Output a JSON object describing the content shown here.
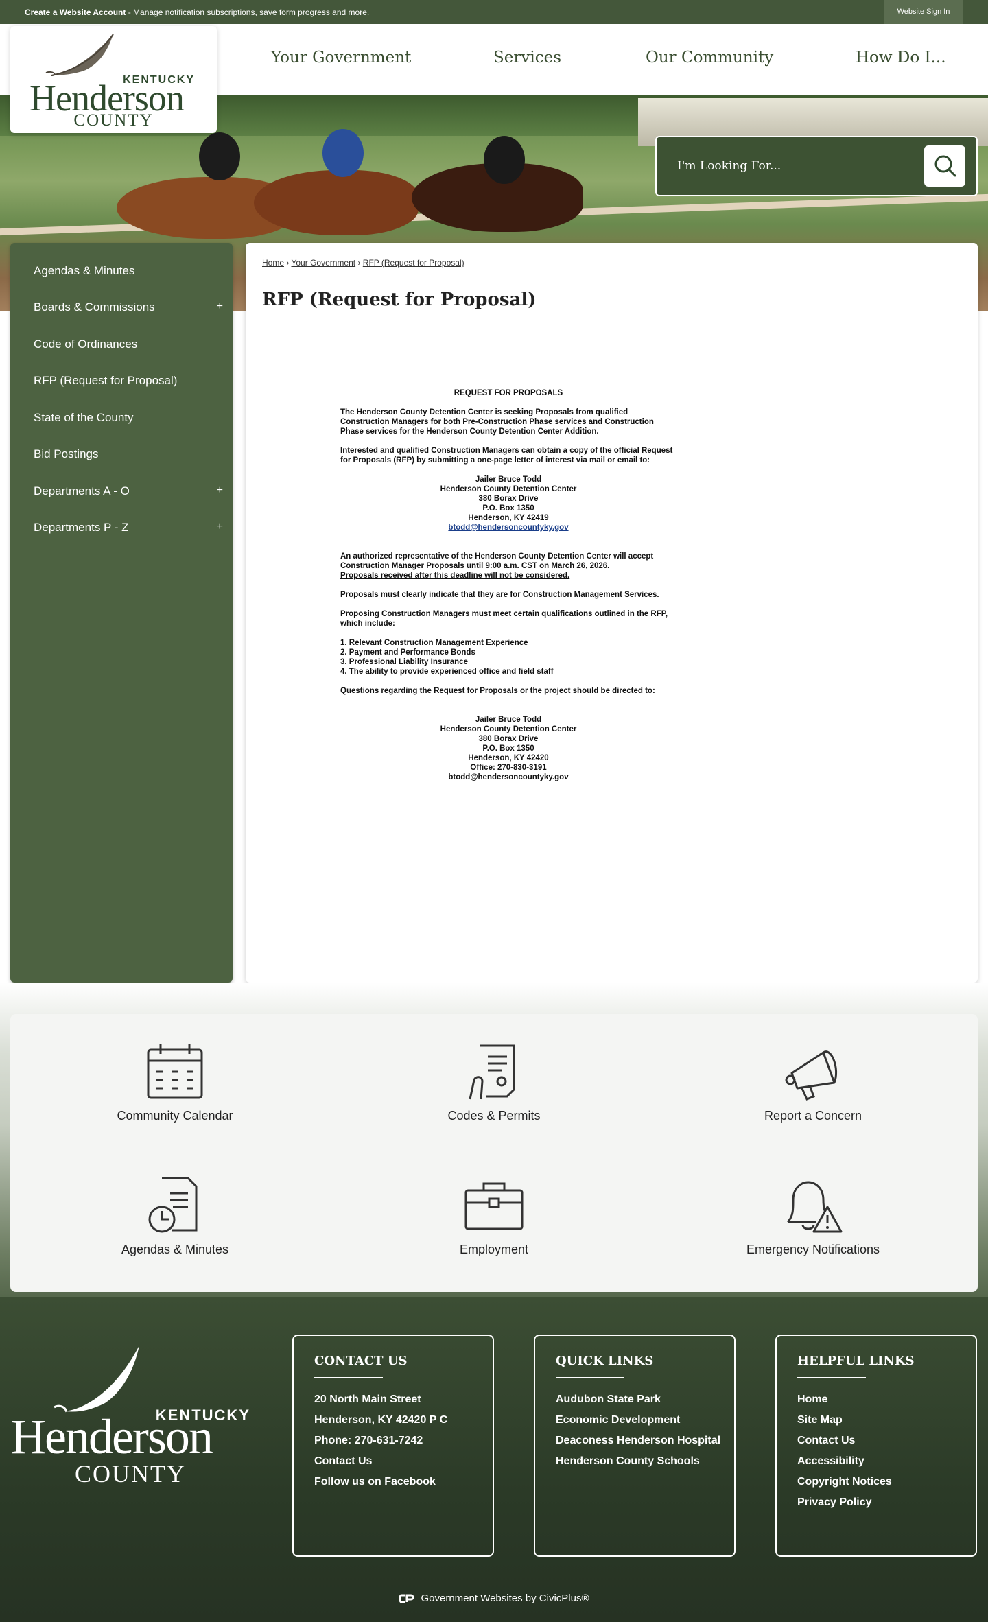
{
  "topbar": {
    "create_account": "Create a Website Account",
    "message": " - Manage notification subscriptions, save form progress and more.",
    "sign_in": "Website Sign In"
  },
  "logo": {
    "state": "KENTUCKY",
    "name": "Henderson",
    "county": "COUNTY"
  },
  "nav": {
    "items": [
      "Your Government",
      "Services",
      "Our Community",
      "How Do I..."
    ]
  },
  "search": {
    "placeholder": "I'm Looking For..."
  },
  "sidebar": {
    "items": [
      {
        "label": "Agendas & Minutes",
        "expandable": false
      },
      {
        "label": "Boards & Commissions",
        "expandable": true
      },
      {
        "label": "Code of Ordinances",
        "expandable": false
      },
      {
        "label": "RFP (Request for Proposal)",
        "expandable": false
      },
      {
        "label": "State of the County",
        "expandable": false
      },
      {
        "label": "Bid Postings",
        "expandable": false
      },
      {
        "label": "Departments A - O",
        "expandable": true
      },
      {
        "label": "Departments P - Z",
        "expandable": true
      }
    ],
    "plus": "+"
  },
  "breadcrumb": {
    "home": "Home",
    "sep": "›",
    "level1": "Your Government",
    "level2": "RFP (Request for Proposal)"
  },
  "page": {
    "title": "RFP (Request for Proposal)"
  },
  "document": {
    "heading": "REQUEST FOR PROPOSALS",
    "para1": "The Henderson County Detention Center is seeking Proposals from qualified Construction Managers for both Pre-Construction Phase services and Construction Phase services for the Henderson County Detention Center Addition.",
    "para2": "Interested and qualified Construction Managers can obtain a copy of the official Request for Proposals (RFP) by submitting a one-page letter of interest via mail or email to:",
    "contact1": {
      "name": "Jailer Bruce Todd",
      "org": "Henderson County Detention Center",
      "street": "380 Borax Drive",
      "box": "P.O. Box 1350",
      "city": "Henderson, KY 42419",
      "email": "btodd@hendersoncountyky.gov"
    },
    "para3": "An authorized representative of the Henderson County Detention Center will accept Construction Manager Proposals until 9:00 a.m. CST on March 26, 2026.",
    "para3_deadline": "Proposals received after this deadline will not be considered.",
    "para4": "Proposals must clearly indicate that they are for Construction Management Services.",
    "para5": "Proposing Construction Managers must meet certain qualifications outlined in the RFP, which include:",
    "list": [
      "1. Relevant Construction Management Experience",
      "2. Payment and Performance Bonds",
      "3. Professional Liability Insurance",
      "4. The ability to provide experienced office and field staff"
    ],
    "para6": "Questions regarding the Request for Proposals or the project should be directed to:",
    "contact2": {
      "name": "Jailer Bruce Todd",
      "org": "Henderson County Detention Center",
      "street": "380 Borax Drive",
      "box": "P.O. Box 1350",
      "city": "Henderson, KY 42420",
      "office": "Office: 270-830-3191",
      "email": "btodd@hendersoncountyky.gov"
    }
  },
  "quicklinks": [
    {
      "label": "Community Calendar",
      "icon": "calendar-icon"
    },
    {
      "label": "Codes & Permits",
      "icon": "permit-document-icon"
    },
    {
      "label": "Report a Concern",
      "icon": "megaphone-icon"
    },
    {
      "label": "Agendas & Minutes",
      "icon": "document-clock-icon"
    },
    {
      "label": "Employment",
      "icon": "briefcase-icon"
    },
    {
      "label": "Emergency Notifications",
      "icon": "bell-alert-icon"
    }
  ],
  "footer": {
    "contact": {
      "title": "CONTACT US",
      "lines": [
        "20 North Main Street",
        "Henderson, KY 42420 P C",
        "Phone: 270-631-7242",
        "Contact Us",
        "Follow us on Facebook"
      ]
    },
    "quick": {
      "title": "QUICK LINKS",
      "lines": [
        "Audubon State Park",
        "Economic Development",
        "Deaconess Henderson Hospital",
        "Henderson County Schools"
      ]
    },
    "helpful": {
      "title": "HELPFUL LINKS",
      "lines": [
        "Home",
        "Site Map",
        "Contact Us",
        "Accessibility",
        "Copyright Notices",
        "Privacy Policy"
      ]
    },
    "civicplus": "Government Websites by CivicPlus®"
  },
  "colors": {
    "brand_green": "#44573a",
    "sidebar_green": "#4d6241",
    "footer_green": "#2b3a27"
  }
}
